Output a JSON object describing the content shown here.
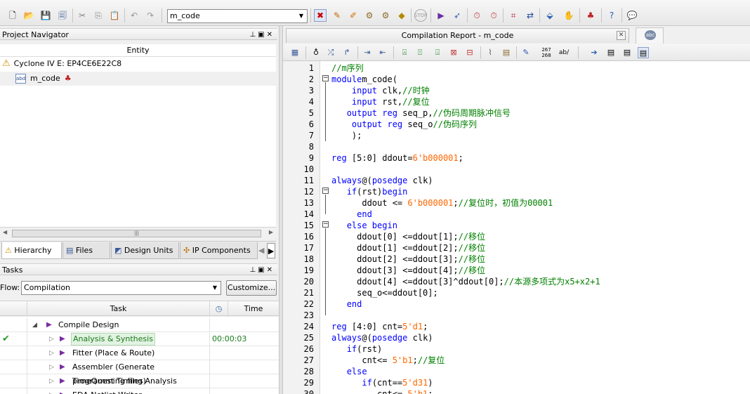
{
  "toolbar": {
    "entity_combo_value": "m_code"
  },
  "project_navigator": {
    "title": "Project Navigator",
    "column_header": "Entity",
    "device": "Cyclone IV E: EP4CE6E22C8",
    "top_entity": "m_code",
    "tabs": [
      "Hierarchy",
      "Files",
      "Design Units",
      "IP Components"
    ]
  },
  "tasks": {
    "title": "Tasks",
    "flow_label": "Flow:",
    "flow_value": "Compilation",
    "customize_label": "Customize...",
    "col_task": "Task",
    "col_time": "Time",
    "rows": [
      {
        "label": "Compile Design",
        "time": ""
      },
      {
        "label": "Analysis & Synthesis",
        "time": "00:00:03"
      },
      {
        "label": "Fitter (Place & Route)",
        "time": ""
      },
      {
        "label": "Assembler (Generate programming files)",
        "time": ""
      },
      {
        "label": "TimeQuest Timing Analysis",
        "time": ""
      },
      {
        "label": "EDA Netlist Writer",
        "time": ""
      }
    ]
  },
  "editor": {
    "tab_title": "Compilation Report - m_code",
    "line_numbers": [
      "1",
      "2",
      "3",
      "4",
      "5",
      "6",
      "7",
      "8",
      "9",
      "10",
      "11",
      "12",
      "13",
      "14",
      "15",
      "16",
      "17",
      "18",
      "19",
      "20",
      "21",
      "22",
      "23",
      "24",
      "25",
      "26",
      "27",
      "28",
      "29",
      "30"
    ],
    "toolbar_counter": "267\n268",
    "toolbar_ab": "ab/"
  },
  "code_lines": [
    [
      [
        "cm",
        "//m序列"
      ]
    ],
    [
      [
        "kw",
        "module"
      ],
      [
        "",
        "m_code("
      ]
    ],
    [
      [
        "",
        "    "
      ],
      [
        "kw",
        "input"
      ],
      [
        "",
        " clk,"
      ],
      [
        "cm",
        "//时钟"
      ]
    ],
    [
      [
        "",
        "    "
      ],
      [
        "kw",
        "input"
      ],
      [
        "",
        " rst,"
      ],
      [
        "cm",
        "//复位"
      ]
    ],
    [
      [
        "",
        "   "
      ],
      [
        "kw",
        "output reg"
      ],
      [
        "",
        " seq_p,"
      ],
      [
        "cm",
        "//伪码周期脉冲信号"
      ]
    ],
    [
      [
        "",
        "    "
      ],
      [
        "kw",
        "output reg"
      ],
      [
        "",
        " seq_o"
      ],
      [
        "cm",
        "//伪码序列"
      ]
    ],
    [
      [
        "",
        "    );"
      ]
    ],
    [
      [
        "",
        ""
      ]
    ],
    [
      [
        "kw",
        "reg"
      ],
      [
        "",
        " [5:0] ddout="
      ],
      [
        "nm",
        "6'b000001"
      ],
      [
        "",
        ";"
      ]
    ],
    [
      [
        "",
        ""
      ]
    ],
    [
      [
        "kw",
        "always"
      ],
      [
        "",
        "@("
      ],
      [
        "kw",
        "posedge"
      ],
      [
        "",
        " clk)"
      ]
    ],
    [
      [
        "",
        "   "
      ],
      [
        "kw",
        "if"
      ],
      [
        "",
        "(rst)"
      ],
      [
        "kw",
        "begin"
      ]
    ],
    [
      [
        "",
        "      ddout <= "
      ],
      [
        "nm",
        "6'b000001"
      ],
      [
        "",
        ";"
      ],
      [
        "cm",
        "//复位时，初值为00001"
      ]
    ],
    [
      [
        "",
        "     "
      ],
      [
        "kw",
        "end"
      ]
    ],
    [
      [
        "",
        "   "
      ],
      [
        "kw",
        "else begin"
      ]
    ],
    [
      [
        "",
        "     ddout[0] <=ddout[1];"
      ],
      [
        "cm",
        "//移位"
      ]
    ],
    [
      [
        "",
        "     ddout[1] <=ddout[2];"
      ],
      [
        "cm",
        "//移位"
      ]
    ],
    [
      [
        "",
        "     ddout[2] <=ddout[3];"
      ],
      [
        "cm",
        "//移位"
      ]
    ],
    [
      [
        "",
        "     ddout[3] <=ddout[4];"
      ],
      [
        "cm",
        "//移位"
      ]
    ],
    [
      [
        "",
        "     ddout[4] <=ddout[3]^ddout[0];"
      ],
      [
        "cm",
        "//本源多项式为x5+x2+1"
      ]
    ],
    [
      [
        "",
        "     seq_o<=ddout[0];"
      ]
    ],
    [
      [
        "",
        "   "
      ],
      [
        "kw",
        "end"
      ]
    ],
    [
      [
        "",
        ""
      ]
    ],
    [
      [
        "kw",
        "reg"
      ],
      [
        "",
        " [4:0] cnt="
      ],
      [
        "nm",
        "5'd1"
      ],
      [
        "",
        ";"
      ]
    ],
    [
      [
        "kw",
        "always"
      ],
      [
        "",
        "@("
      ],
      [
        "kw",
        "posedge"
      ],
      [
        "",
        " clk)"
      ]
    ],
    [
      [
        "",
        "   "
      ],
      [
        "kw",
        "if"
      ],
      [
        "",
        "(rst)"
      ]
    ],
    [
      [
        "",
        "      cnt<= "
      ],
      [
        "nm",
        "5'b1"
      ],
      [
        "",
        ";"
      ],
      [
        "cm",
        "//复位"
      ]
    ],
    [
      [
        "",
        "   "
      ],
      [
        "kw",
        "else"
      ]
    ],
    [
      [
        "",
        "      "
      ],
      [
        "kw",
        "if"
      ],
      [
        "",
        "(cnt=="
      ],
      [
        "nm",
        "5'd31"
      ],
      [
        "",
        ")"
      ]
    ],
    [
      [
        "",
        "         cnt<= "
      ],
      [
        "nm",
        "5'b1"
      ],
      [
        "",
        ";"
      ]
    ]
  ],
  "colors": {
    "keyword": "#0000ff",
    "comment": "#008000",
    "number": "#ff6600",
    "accent_purple": "#7a2ba3"
  }
}
